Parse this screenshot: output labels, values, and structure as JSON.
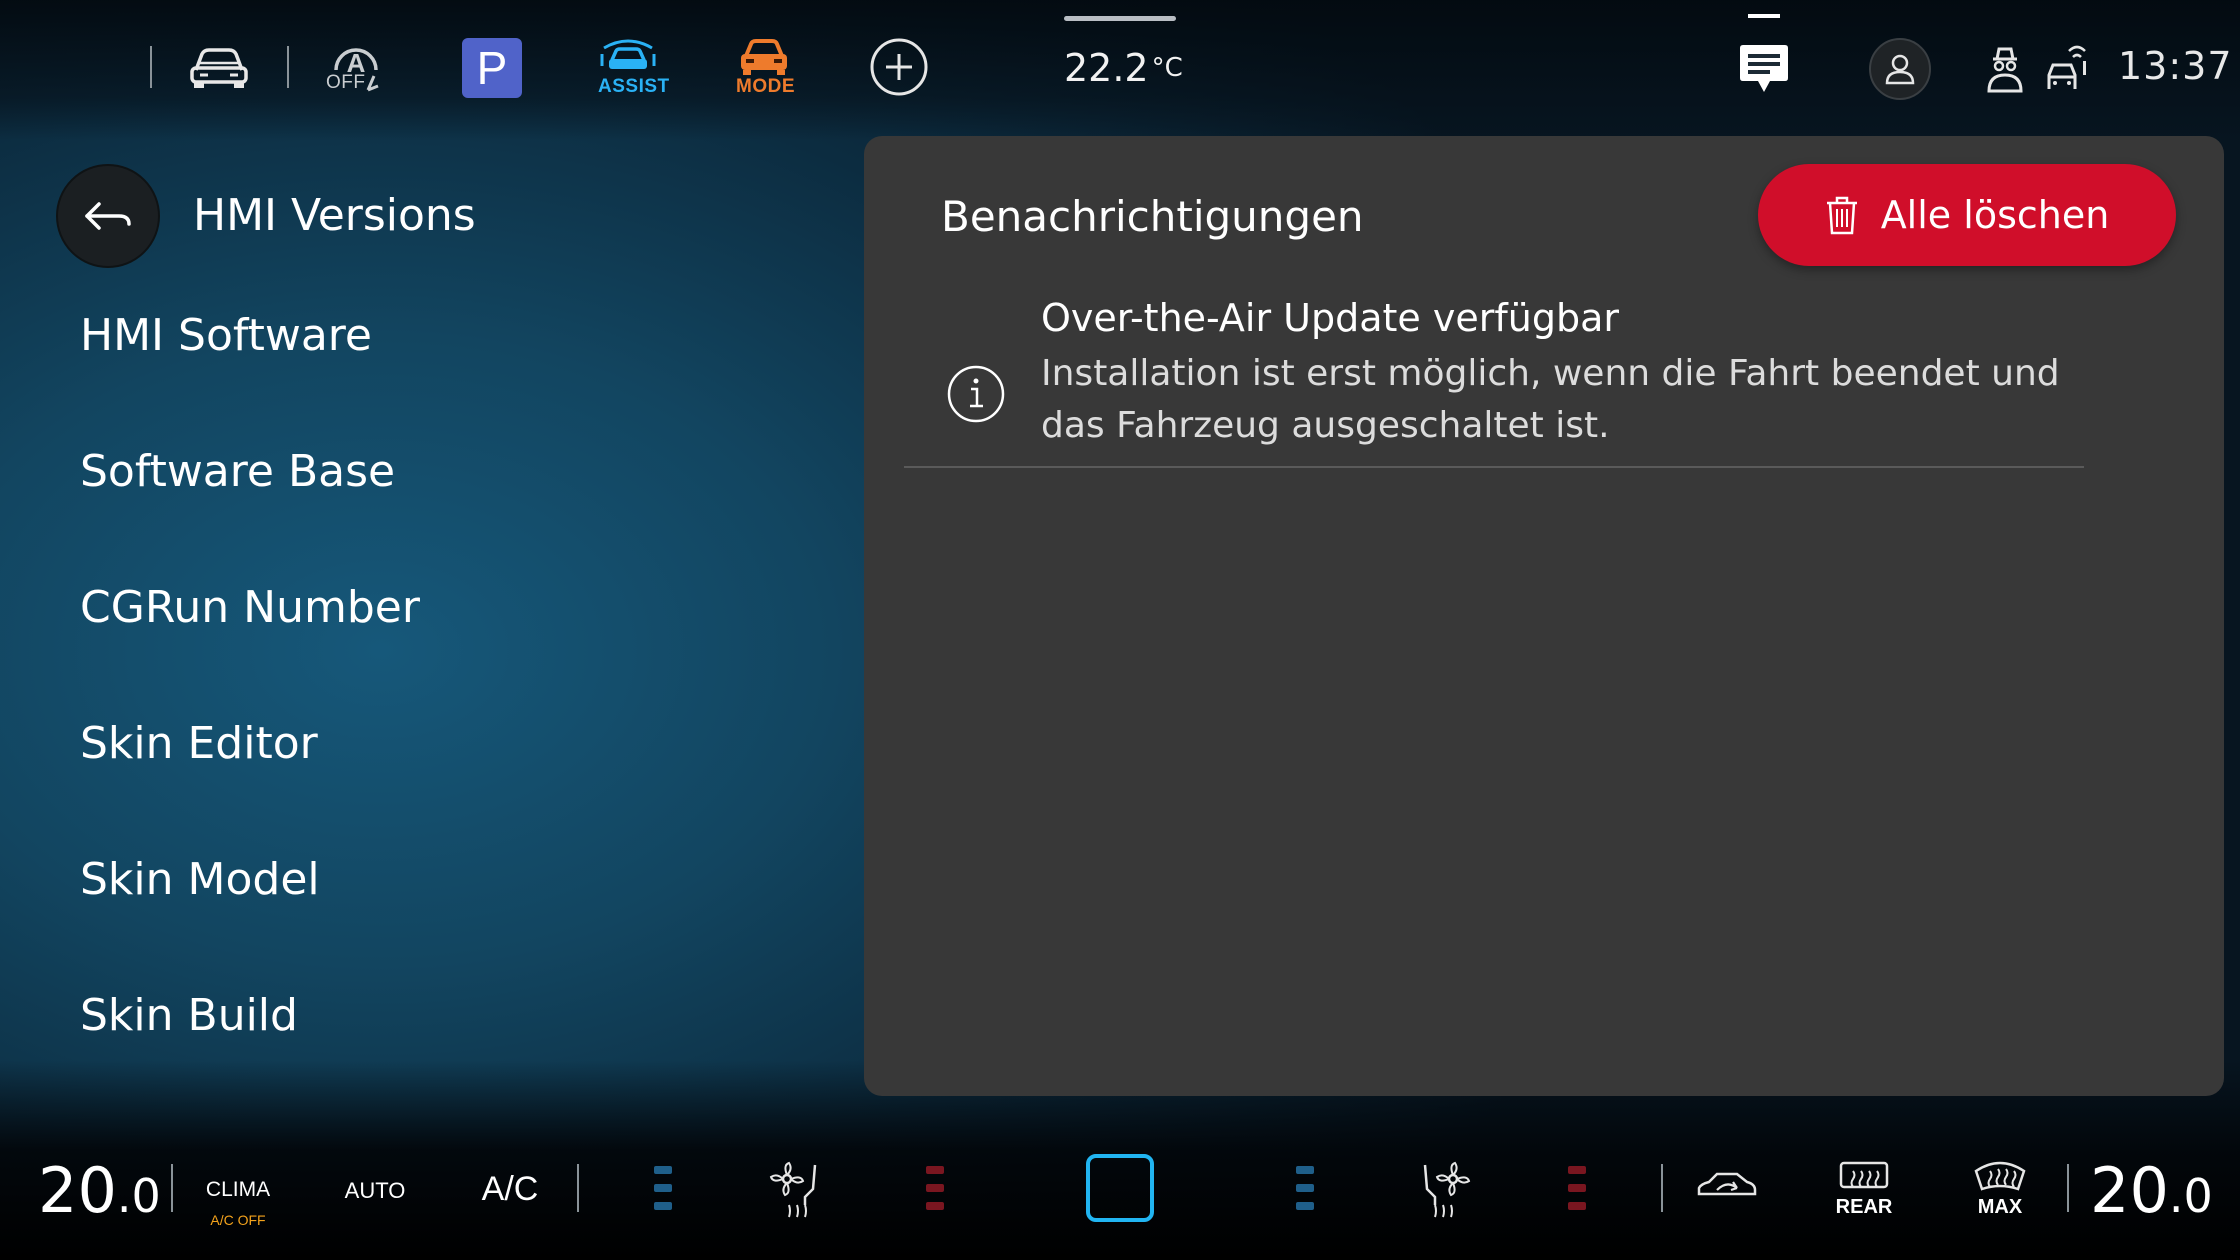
{
  "topbar": {
    "off_label": "OFF",
    "parking_label": "P",
    "assist_label": "ASSIST",
    "mode_label": "MODE",
    "outside_temp": "22.2",
    "outside_temp_unit": "°C",
    "clock": "13:37",
    "colors": {
      "apps": "#1ea7ff",
      "assist": "#2ab2f5",
      "mode": "#ee7b2c",
      "parking": "#5063c9"
    }
  },
  "left": {
    "title": "HMI Versions",
    "items": [
      {
        "label": "HMI Software"
      },
      {
        "label": "Software Base"
      },
      {
        "label": "CGRun Number"
      },
      {
        "label": "Skin Editor"
      },
      {
        "label": "Skin Model"
      },
      {
        "label": "Skin Build"
      }
    ]
  },
  "notifications": {
    "title": "Benachrichtigungen",
    "clear_all_label": "Alle löschen",
    "accent": "#d00e2a",
    "items": [
      {
        "icon": "info-icon",
        "title": "Over-the-Air Update verfügbar",
        "body": "Installation ist erst möglich, wenn die Fahrt beendet und das Fahrzeug ausgeschaltet ist."
      }
    ]
  },
  "climate": {
    "left_temp_int": "20",
    "left_temp_dec": ".0",
    "right_temp_int": "20",
    "right_temp_dec": ".0",
    "clima_label": "CLIMA",
    "ac_off_label": "A/C OFF",
    "auto_label": "AUTO",
    "ac_label": "A/C",
    "rear_label": "REAR",
    "max_label": "MAX",
    "colors": {
      "heat_level": "#7a1620",
      "cool_level": "#1f5f8a",
      "ac_off": "#f3a21c",
      "center_square": "#21b5f2"
    }
  }
}
